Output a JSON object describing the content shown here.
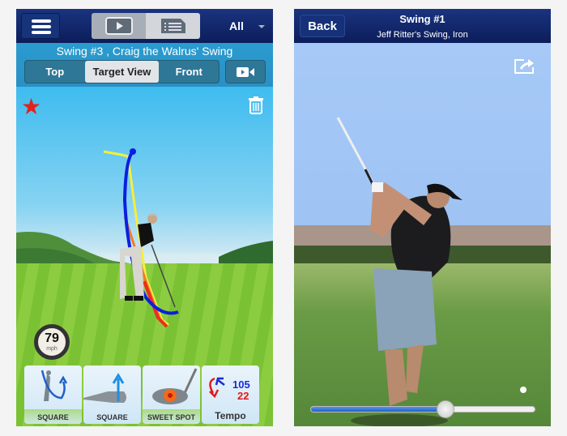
{
  "left_screen": {
    "navbar": {
      "menu_icon": "hamburger-icon",
      "play_icon": "video-play-icon",
      "list_icon": "list-document-icon",
      "filter_label": "All"
    },
    "subtitle": "Swing #3 , Craig the Walrus' Swing",
    "tabs": [
      {
        "label": "Top",
        "selected": false
      },
      {
        "label": "Target View",
        "selected": true
      },
      {
        "label": "Front",
        "selected": false
      }
    ],
    "camera_icon": "video-camera-icon",
    "favorite_icon": "star-icon",
    "delete_icon": "trash-icon",
    "speed": {
      "value": "79",
      "unit": "mph"
    },
    "metric_cards": [
      {
        "label": "SQUARE",
        "icon": "swing-path-icon"
      },
      {
        "label": "SQUARE",
        "icon": "club-face-icon"
      },
      {
        "label": "SWEET SPOT",
        "icon": "sweet-spot-icon"
      },
      {
        "label": "Tempo",
        "backswing": "105",
        "downswing": "22",
        "icon": "tempo-icon"
      }
    ],
    "colors": {
      "navbar": "#0c1d5a",
      "accent_blue": "#1a3480",
      "favorite": "#e0231d",
      "tempo_back": "#1a2ad6",
      "tempo_down": "#e01a1a"
    }
  },
  "right_screen": {
    "navbar": {
      "back_label": "Back",
      "title": "Swing #1",
      "subtitle": "Jeff Ritter's Swing, Iron"
    },
    "share_icon": "share-icon",
    "playback": {
      "progress": 0.6
    }
  }
}
